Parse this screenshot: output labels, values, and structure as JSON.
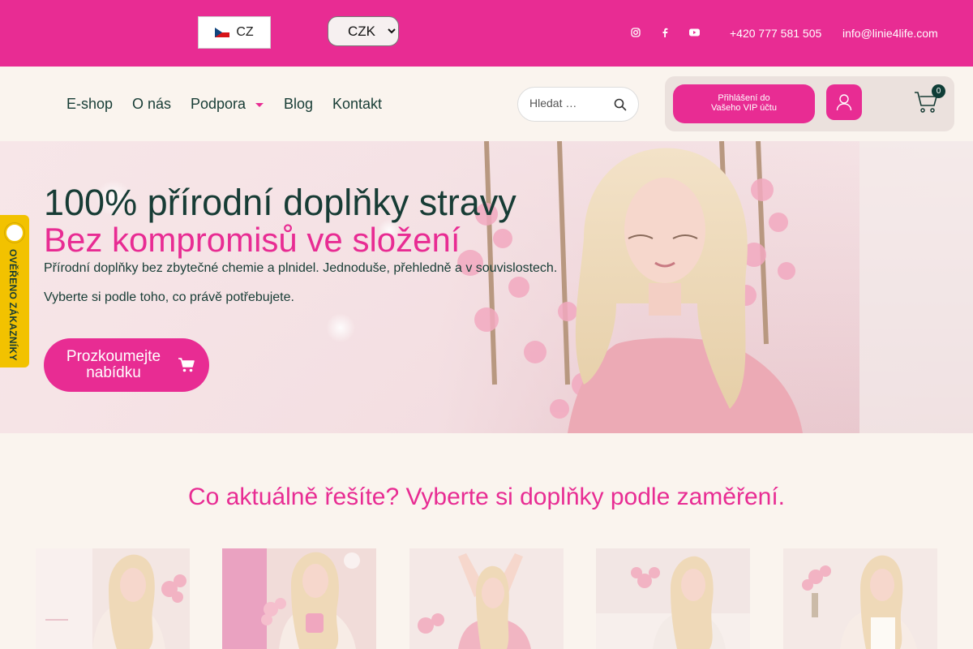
{
  "topbar": {
    "language": "CZ",
    "currency_options": [
      "CZK"
    ],
    "currency_selected": "CZK",
    "phone": "+420 777 581 505",
    "email": "info@linie4life.com",
    "social_icons": [
      "instagram-icon",
      "facebook-icon",
      "youtube-icon"
    ],
    "bg_color": "#e82c93"
  },
  "nav": {
    "items": [
      {
        "label": "E-shop"
      },
      {
        "label": "O nás"
      },
      {
        "label": "Podpora"
      },
      {
        "label": "Blog"
      },
      {
        "label": "Kontakt"
      }
    ],
    "search_placeholder": "Hledat …",
    "vip_login": "Přihlášení do\nVašeho VIP účtu",
    "cart_count": "0"
  },
  "hero": {
    "title1": "100% přírodní doplňky stravy",
    "title2": "Bez kompromisů ve složení",
    "text1": "Přírodní doplňky bez zbytečné chemie a plnidel. Jednoduše, přehledně a v souvislostech.",
    "text2": "Vyberte si podle toho, co právě potřebujete.",
    "cta": "Prozkoumejte nabídku"
  },
  "side_badge": {
    "label": "OVĚŘENO ZÁKAZNÍKY"
  },
  "section": {
    "title": "Co aktuálně řešíte? Vyberte si doplňky podle zaměření."
  },
  "colors": {
    "accent": "#e82c93",
    "dark_green": "#173c35",
    "background": "#faf4ee",
    "badge_yellow": "#f2c200"
  }
}
